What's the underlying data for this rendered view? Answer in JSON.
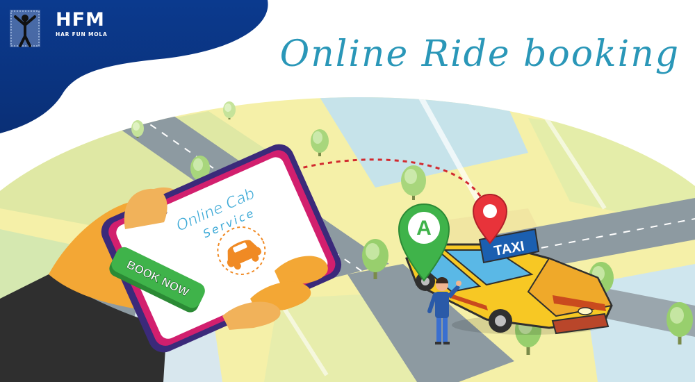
{
  "header": {
    "title": "Online Ride booking"
  },
  "logo": {
    "abbreviation": "HFM",
    "tagline": "HAR FUN MOLA"
  },
  "phone": {
    "screen_title": "Online Cab",
    "screen_subtitle": "Service",
    "button_label": "BOOK NOW"
  },
  "map": {
    "pickup_marker_letter": "A",
    "taxi_sign": "TAXI"
  },
  "colors": {
    "brand_blue": "#0f3f8f",
    "title_teal": "#2a97b8",
    "button_green": "#3fb34a",
    "taxi_yellow": "#f7c824",
    "marker_red": "#e8333a"
  }
}
